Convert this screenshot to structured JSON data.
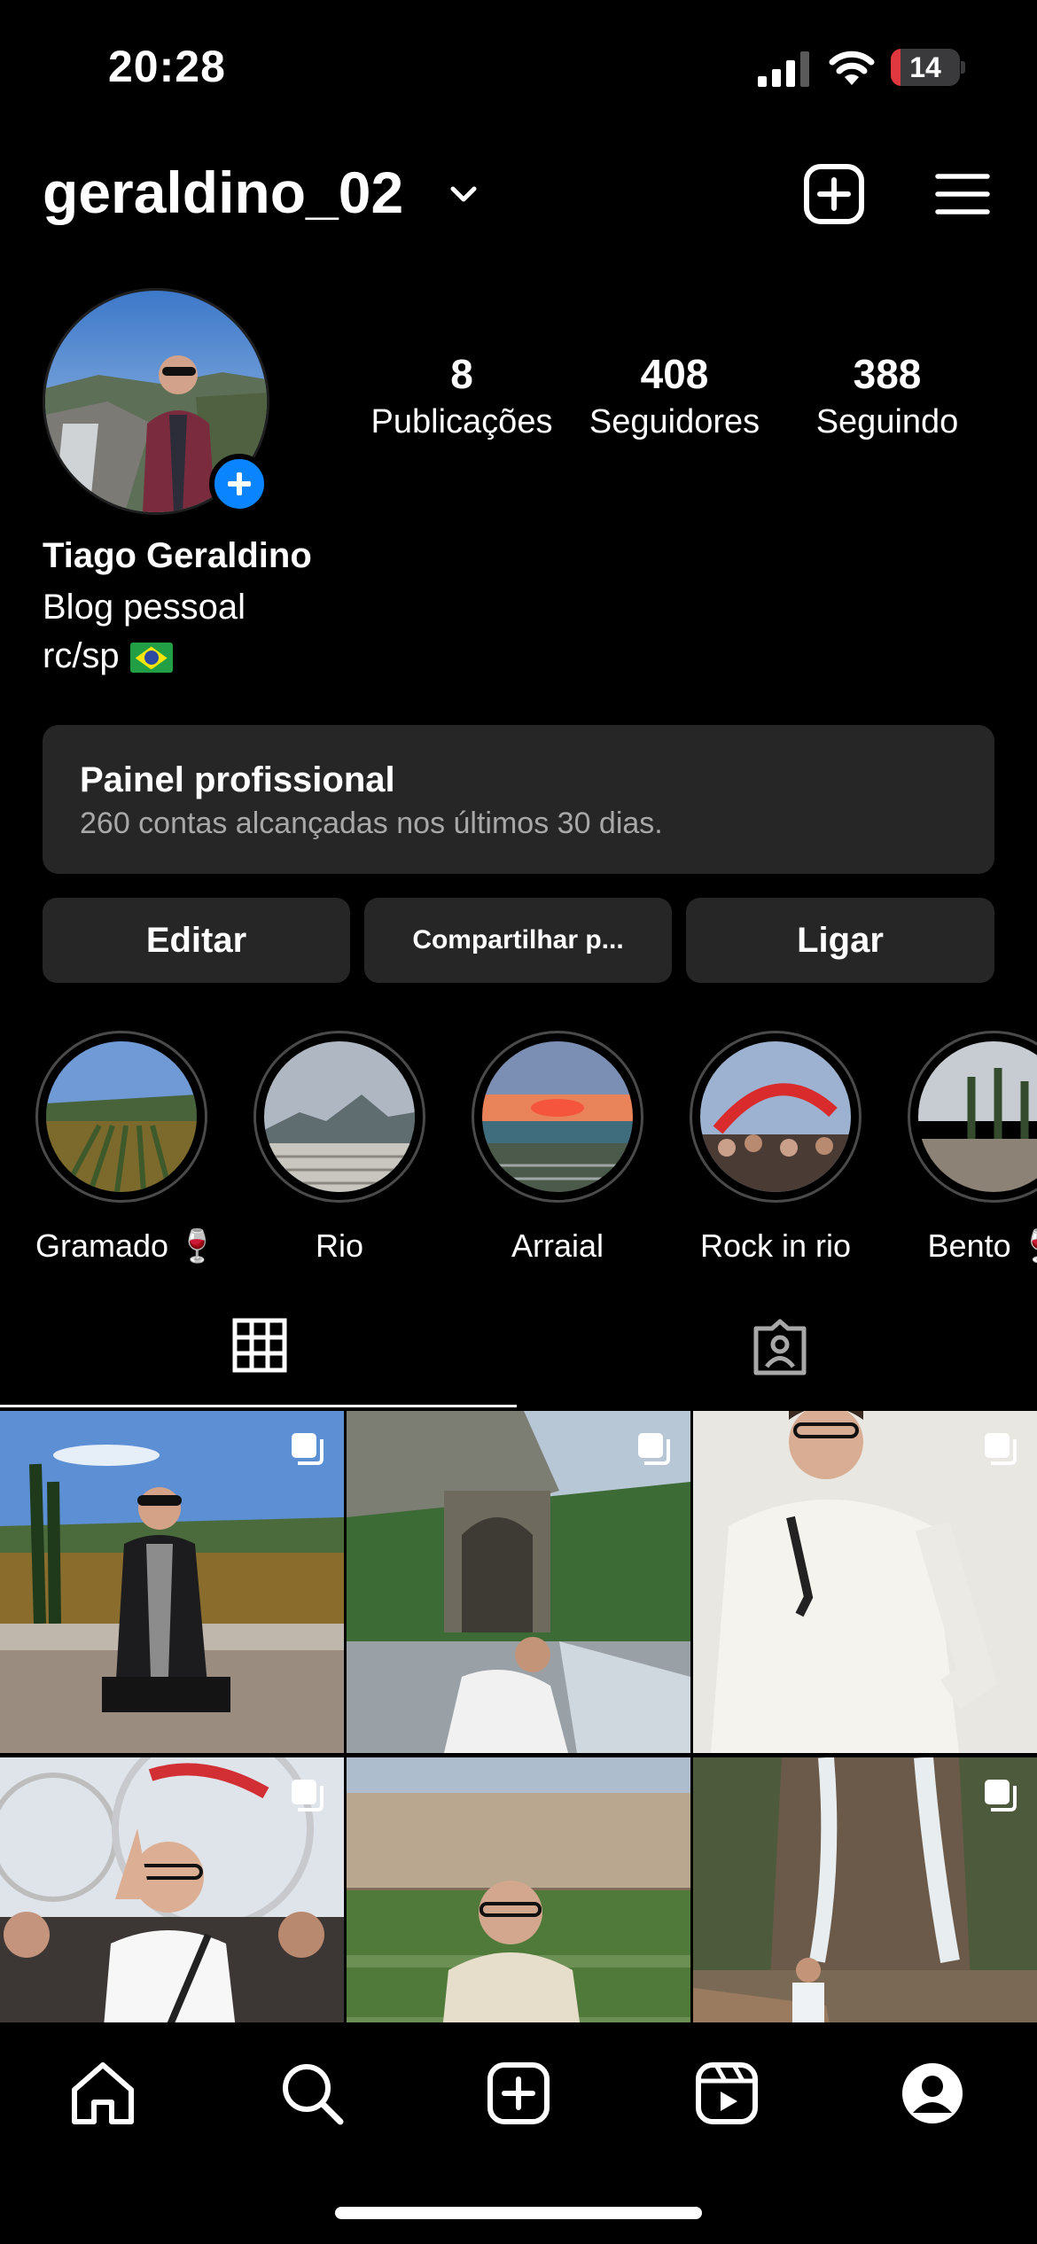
{
  "status_bar": {
    "time": "20:28",
    "battery": "14",
    "battery_level": 0.14
  },
  "header": {
    "username": "geraldino_02"
  },
  "profile": {
    "stats": [
      {
        "value": "8",
        "label": "Publicações"
      },
      {
        "value": "408",
        "label": "Seguidores"
      },
      {
        "value": "388",
        "label": "Seguindo"
      }
    ],
    "name": "Tiago Geraldino",
    "bio_line1": "Blog pessoal",
    "bio_line2": "rc/sp"
  },
  "panel": {
    "title": "Painel profissional",
    "subtitle": "260 contas alcançadas nos últimos 30 dias."
  },
  "buttons": {
    "edit": "Editar",
    "share": "Compartilhar p...",
    "call": "Ligar"
  },
  "highlights": [
    {
      "label": "Gramado 🍷"
    },
    {
      "label": "Rio"
    },
    {
      "label": "Arraial"
    },
    {
      "label": "Rock in rio"
    },
    {
      "label": "Bento 🍷"
    }
  ],
  "tabs": [
    "grid-icon",
    "tagged-icon"
  ],
  "nav": [
    "home-icon",
    "search-icon",
    "create-icon",
    "reels-icon",
    "profile-icon"
  ],
  "colors": {
    "accent": "#0a84ff",
    "panel": "#262626",
    "battery_low": "#e0383e"
  }
}
